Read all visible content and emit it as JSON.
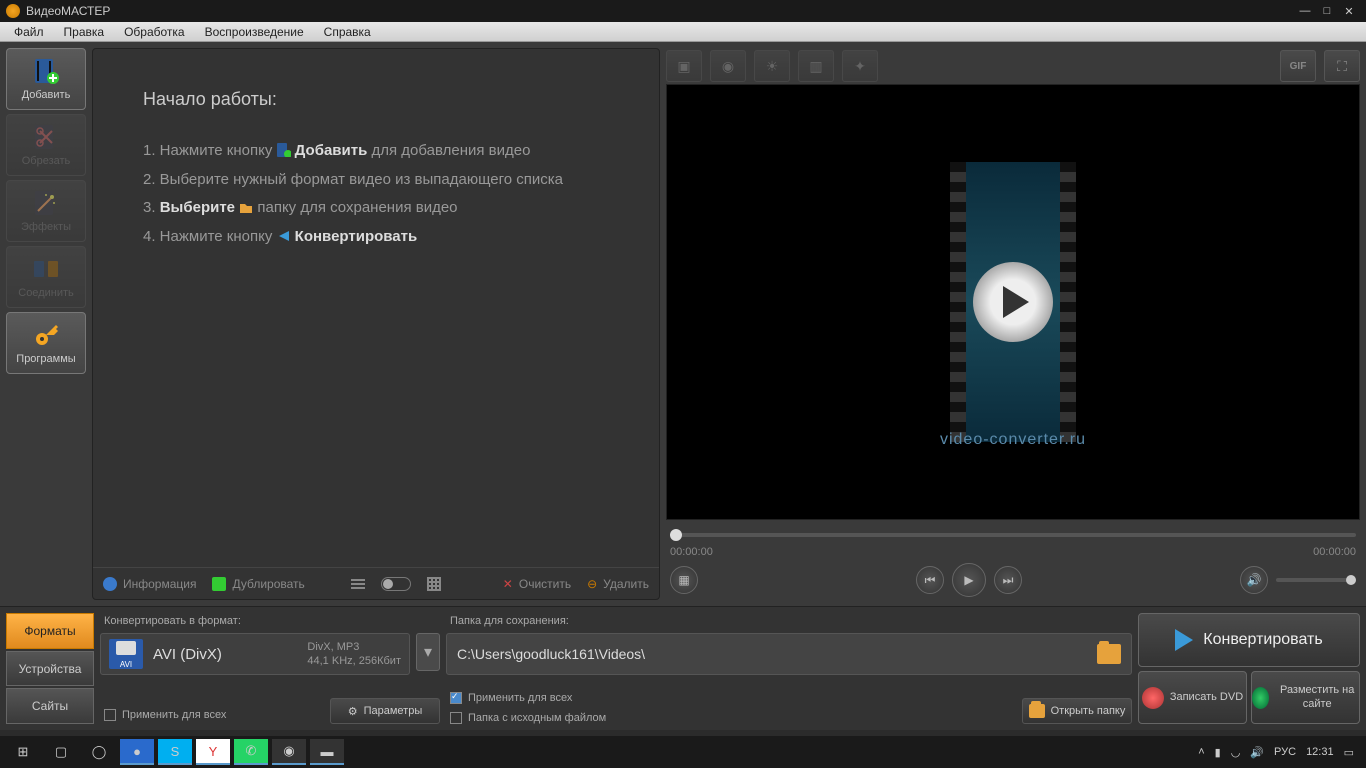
{
  "title": "ВидеоМАСТЕР",
  "menu": [
    "Файл",
    "Правка",
    "Обработка",
    "Воспроизведение",
    "Справка"
  ],
  "sidebar": [
    {
      "label": "Добавить",
      "name": "add-button",
      "active": true,
      "color": "#3a9ad9",
      "plus": true
    },
    {
      "label": "Обрезать",
      "name": "trim-button",
      "disabled": true,
      "color": "#c44"
    },
    {
      "label": "Эффекты",
      "name": "effects-button",
      "disabled": true,
      "color": "#a6f"
    },
    {
      "label": "Соединить",
      "name": "join-button",
      "disabled": true,
      "color": "#6af"
    },
    {
      "label": "Программы",
      "name": "programs-button",
      "color": "#f5a623"
    }
  ],
  "welcome": {
    "title": "Начало работы:",
    "step1_a": "1. Нажмите кнопку ",
    "step1_b": "Добавить",
    "step1_c": " для добавления видео",
    "step2": "2. Выберите нужный формат видео из выпадающего списка",
    "step3_a": "3. ",
    "step3_b": "Выберите",
    "step3_c": " папку для сохранения видео",
    "step4_a": "4. Нажмите кнопку ",
    "step4_b": "Конвертировать"
  },
  "centerBottom": {
    "info": "Информация",
    "dup": "Дублировать",
    "clear": "Очистить",
    "del": "Удалить"
  },
  "preview": {
    "url": "video-converter.ru",
    "t0": "00:00:00",
    "t1": "00:00:00",
    "gif": "GIF"
  },
  "tabs": [
    "Форматы",
    "Устройства",
    "Сайты"
  ],
  "format": {
    "label": "Конвертировать в формат:",
    "iconTag": "AVI",
    "name": "AVI (DivX)",
    "line1": "DivX, MP3",
    "line2": "44,1 KHz, 256Кбит",
    "applyAll": "Применить для всех",
    "params": "Параметры"
  },
  "folder": {
    "label": "Папка для сохранения:",
    "path": "C:\\Users\\goodluck161\\Videos\\",
    "applyAll": "Применить для всех",
    "source": "Папка с исходным файлом",
    "open": "Открыть папку"
  },
  "actions": {
    "convert": "Конвертировать",
    "dvd": "Записать DVD",
    "publish": "Разместить на сайте"
  },
  "tray": {
    "lang": "РУС",
    "time": "12:31"
  }
}
